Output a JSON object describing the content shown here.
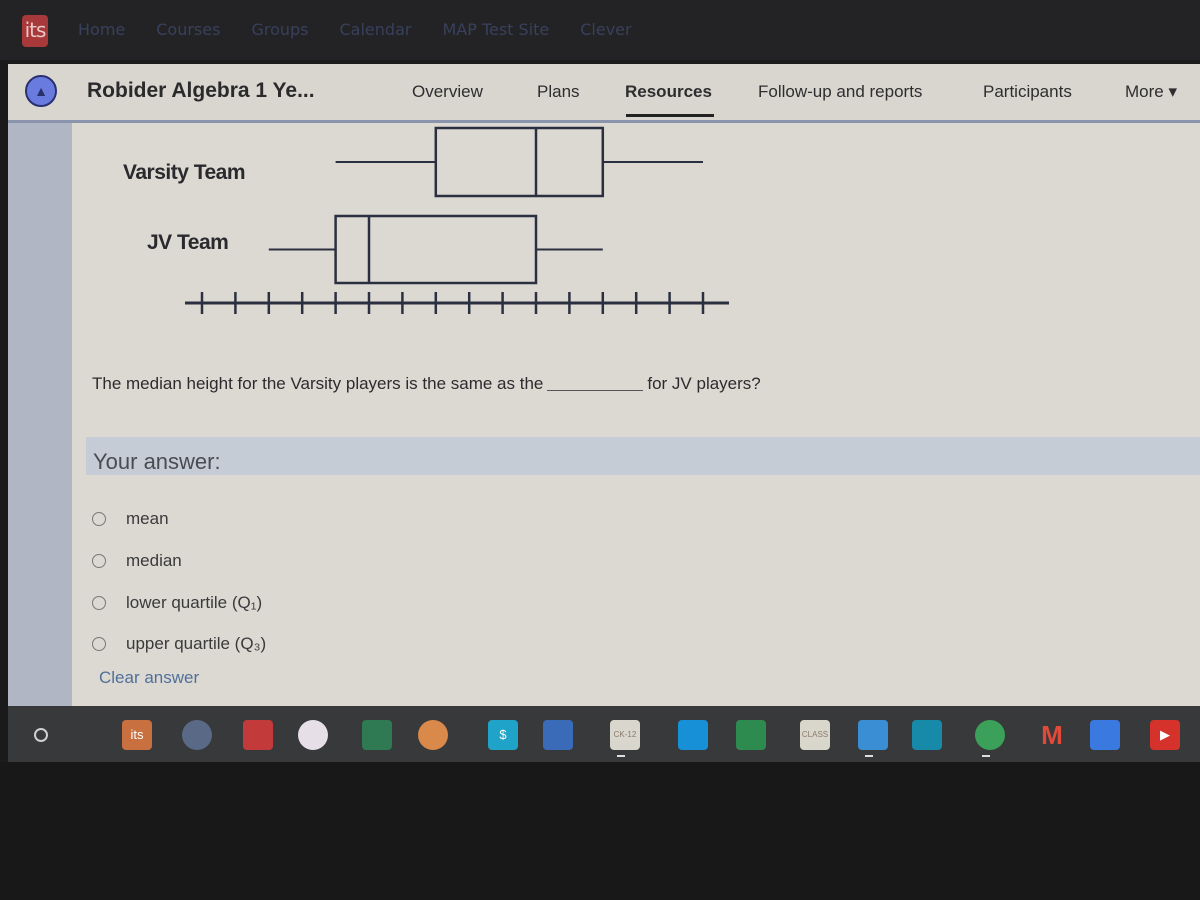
{
  "topbar": {
    "logo": "its",
    "nav": [
      "Home",
      "Courses",
      "Groups",
      "Calendar",
      "MAP Test Site",
      "Clever"
    ]
  },
  "course": {
    "icon": "graduation-cap-icon",
    "title": "Robider Algebra 1 Ye...",
    "tabs": [
      {
        "label": "Overview",
        "active": false
      },
      {
        "label": "Plans",
        "active": false
      },
      {
        "label": "Resources",
        "active": true
      },
      {
        "label": "Follow-up and reports",
        "active": false
      },
      {
        "label": "Participants",
        "active": false
      },
      {
        "label": "More ▾",
        "active": false
      }
    ]
  },
  "question": {
    "prefix": "The median height for the Varsity players is the same as the",
    "suffix": "for JV players?",
    "answer_label": "Your answer:",
    "options": [
      "mean",
      "median",
      "lower quartile (Q₁)",
      "upper quartile (Q₃)"
    ],
    "clear_label": "Clear answer"
  },
  "chart_data": {
    "type": "boxplot",
    "title": "",
    "xlabel": "",
    "ylabel": "",
    "axis": {
      "ticks": 16,
      "tick_labels": [],
      "range_in_tick_units": [
        0,
        15
      ]
    },
    "series": [
      {
        "name": "Varsity Team",
        "min": 4,
        "q1": 7,
        "median": 10,
        "q3": 12,
        "max": 15
      },
      {
        "name": "JV Team",
        "min": 2,
        "q1": 4,
        "median": 5,
        "q3": 10,
        "max": 12
      }
    ],
    "grid": false
  },
  "shelf": {
    "launcher": "launcher-icon",
    "apps": [
      {
        "name": "its-app-icon",
        "label": "its",
        "color": "#c8703f"
      },
      {
        "name": "camera-app-icon",
        "label": "",
        "color": "#5a6a86"
      },
      {
        "name": "red-cube-app-icon",
        "label": "",
        "color": "#c23a3a"
      },
      {
        "name": "galaxy-app-icon",
        "label": "",
        "color": "#e6dfe8"
      },
      {
        "name": "desmos-app-icon",
        "label": "",
        "color": "#2f7a52"
      },
      {
        "name": "share-app-icon",
        "label": "",
        "color": "#d9894a"
      },
      {
        "name": "sb-app-icon",
        "label": "$",
        "color": "#1fa3c9"
      },
      {
        "name": "butterfly-app-icon",
        "label": "",
        "color": "#3a6bb8"
      },
      {
        "name": "ck12-app-icon",
        "label": "CK-12",
        "color": "#d8d6cd"
      },
      {
        "name": "typingclub-app-icon",
        "label": "",
        "color": "#1890d8"
      },
      {
        "name": "google-classroom-app-icon",
        "label": "",
        "color": "#2e8b50"
      },
      {
        "name": "ixl-class-app-icon",
        "label": "CLASS",
        "color": "#d9d6cc"
      },
      {
        "name": "google-drive-app-icon",
        "label": "",
        "color": "#3a8fd4"
      },
      {
        "name": "discovery-app-icon",
        "label": "",
        "color": "#168aa8"
      },
      {
        "name": "chrome-app-icon",
        "label": "",
        "color": "#3aa05a"
      },
      {
        "name": "gmail-app-icon",
        "label": "M",
        "color": "#e04a3a"
      },
      {
        "name": "google-docs-app-icon",
        "label": "",
        "color": "#3a7ae0"
      },
      {
        "name": "youtube-app-icon",
        "label": "▶",
        "color": "#d5322c"
      }
    ]
  }
}
